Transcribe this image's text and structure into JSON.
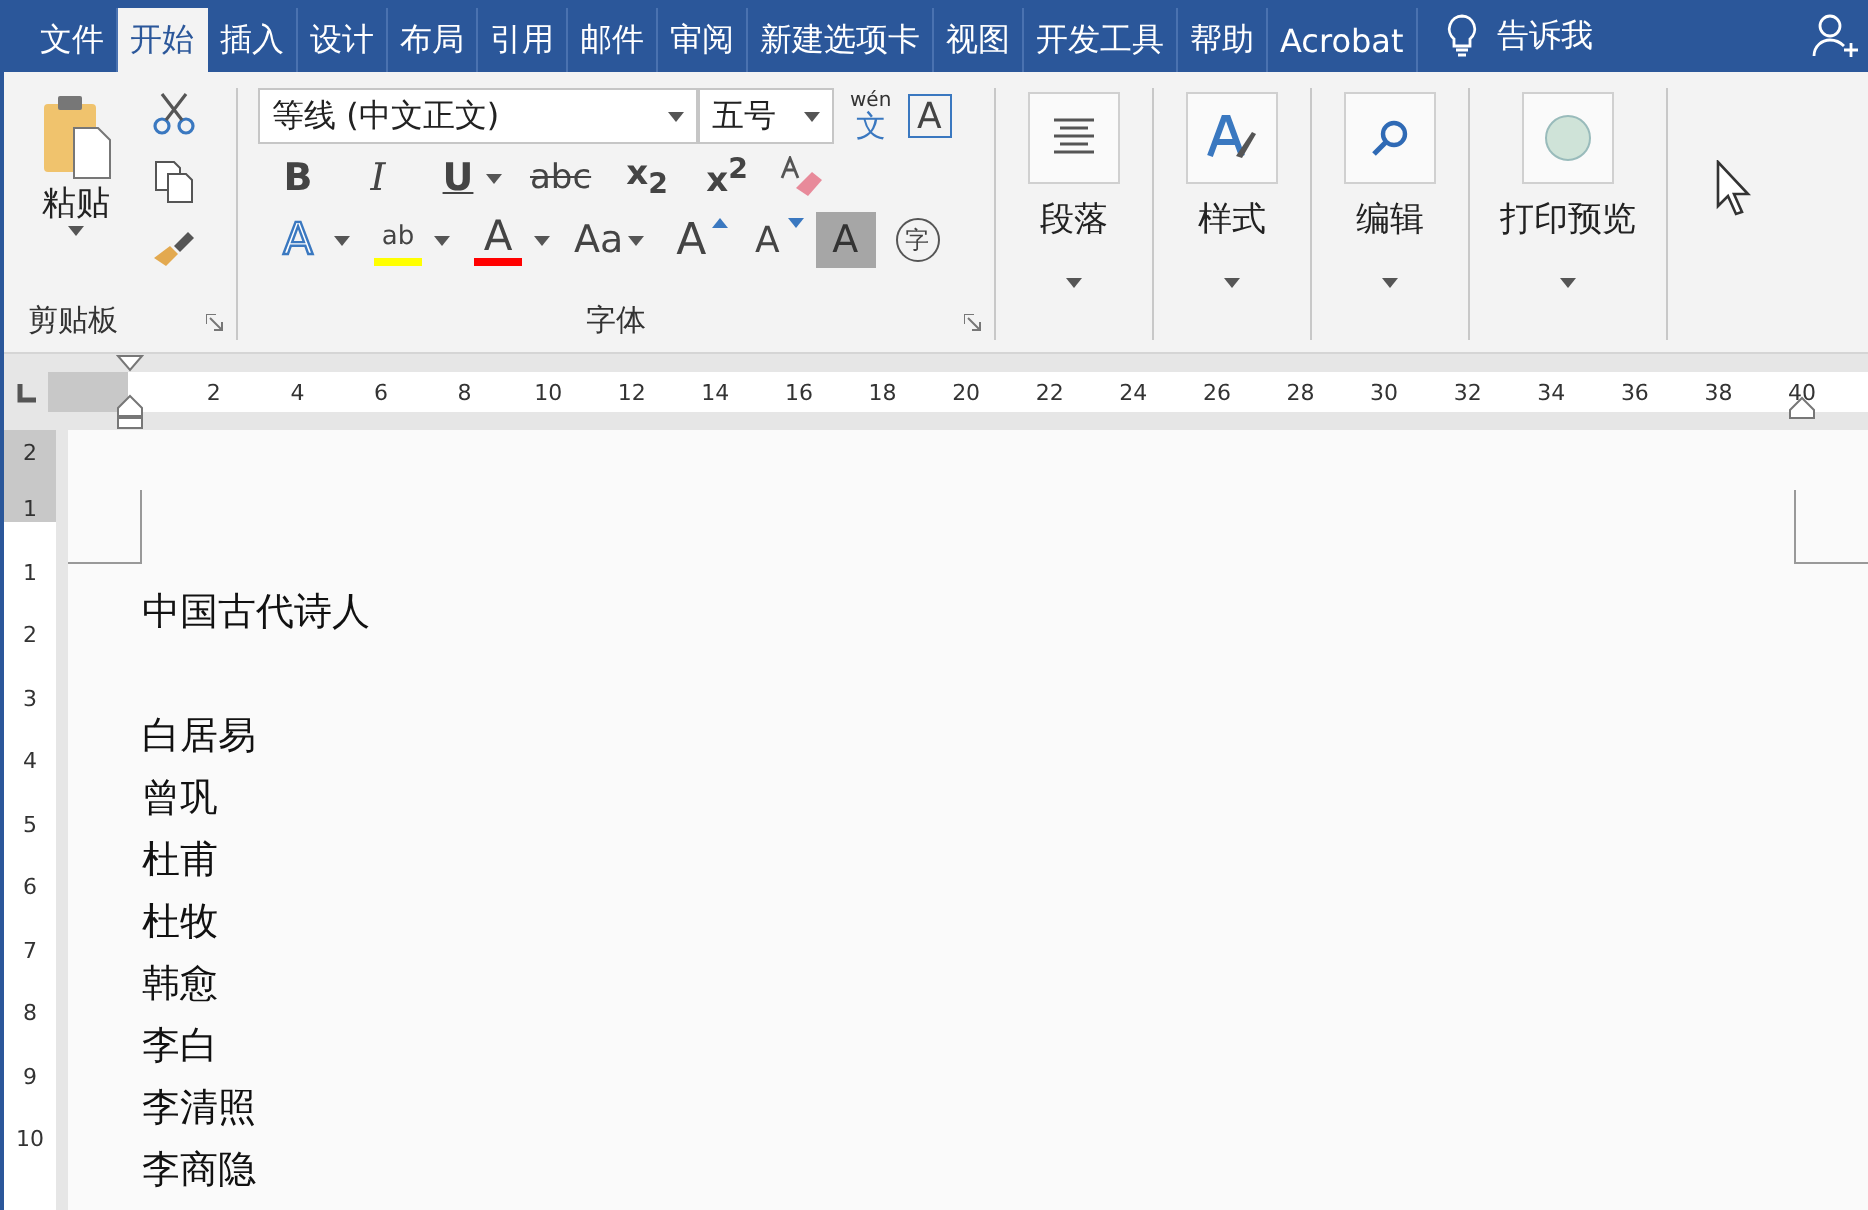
{
  "tabs": [
    {
      "label": "文件",
      "selected": false
    },
    {
      "label": "开始",
      "selected": true
    },
    {
      "label": "插入",
      "selected": false
    },
    {
      "label": "设计",
      "selected": false
    },
    {
      "label": "布局",
      "selected": false
    },
    {
      "label": "引用",
      "selected": false
    },
    {
      "label": "邮件",
      "selected": false
    },
    {
      "label": "审阅",
      "selected": false
    },
    {
      "label": "新建选项卡",
      "selected": false
    },
    {
      "label": "视图",
      "selected": false
    },
    {
      "label": "开发工具",
      "selected": false
    },
    {
      "label": "帮助",
      "selected": false
    },
    {
      "label": "Acrobat",
      "selected": false
    }
  ],
  "tell_me": "告诉我",
  "clipboard": {
    "paste": "粘贴",
    "label": "剪贴板"
  },
  "font": {
    "font_name": "等线 (中文正文)",
    "font_size": "五号",
    "phonetic_top": "wén",
    "phonetic_char": "文",
    "border_char": "A",
    "label": "字体",
    "row_1": [
      {
        "kind": "bold",
        "label": "B"
      },
      {
        "kind": "italic",
        "label": "I"
      },
      {
        "kind": "underline",
        "label": "U"
      },
      {
        "kind": "strike",
        "label": "abc"
      },
      {
        "kind": "script",
        "label": "x$_{2}$"
      },
      {
        "kind": "script",
        "label": "x$^{2}$"
      },
      {
        "kind": "eraser"
      }
    ],
    "row_2": [
      {
        "kind": "effects",
        "label": "A"
      },
      {
        "kind": "highlight",
        "label": "ab",
        "color": "#ffff00"
      },
      {
        "kind": "fontcolor",
        "label": "A",
        "color": "#ff0000"
      },
      {
        "kind": "case",
        "label": "Aa"
      },
      {
        "kind": "grow",
        "label": "A"
      },
      {
        "kind": "shrink",
        "label": "A"
      },
      {
        "kind": "shade",
        "label": "A"
      },
      {
        "kind": "enclose",
        "label": "字"
      }
    ]
  },
  "big_groups": [
    {
      "kind": "paragraph",
      "label": "段落"
    },
    {
      "kind": "styles",
      "label": "样式"
    },
    {
      "kind": "editing",
      "label": "编辑"
    },
    {
      "kind": "preview",
      "label": "打印预览"
    }
  ],
  "horizontal_ruler": [
    "2",
    "4",
    "6",
    "8",
    "10",
    "12",
    "14",
    "16",
    "18",
    "20",
    "22",
    "24",
    "26",
    "28",
    "30",
    "32",
    "34",
    "36",
    "38",
    "40"
  ],
  "vertical_ruler": [
    {
      "label": "2",
      "margin": true
    },
    {
      "label": "1",
      "margin": true
    },
    {
      "label": "1",
      "margin": false
    },
    {
      "label": "2",
      "margin": false
    },
    {
      "label": "3",
      "margin": false
    },
    {
      "label": "4",
      "margin": false
    },
    {
      "label": "5",
      "margin": false
    },
    {
      "label": "6",
      "margin": false
    },
    {
      "label": "7",
      "margin": false
    },
    {
      "label": "8",
      "margin": false
    },
    {
      "label": "9",
      "margin": false
    },
    {
      "label": "10",
      "margin": false
    }
  ],
  "document_title": "中国古代诗人",
  "document_lines": [
    "白居易",
    "曾巩",
    "杜甫",
    "杜牧",
    "韩愈",
    "李白",
    "李清照",
    "李商隐"
  ]
}
